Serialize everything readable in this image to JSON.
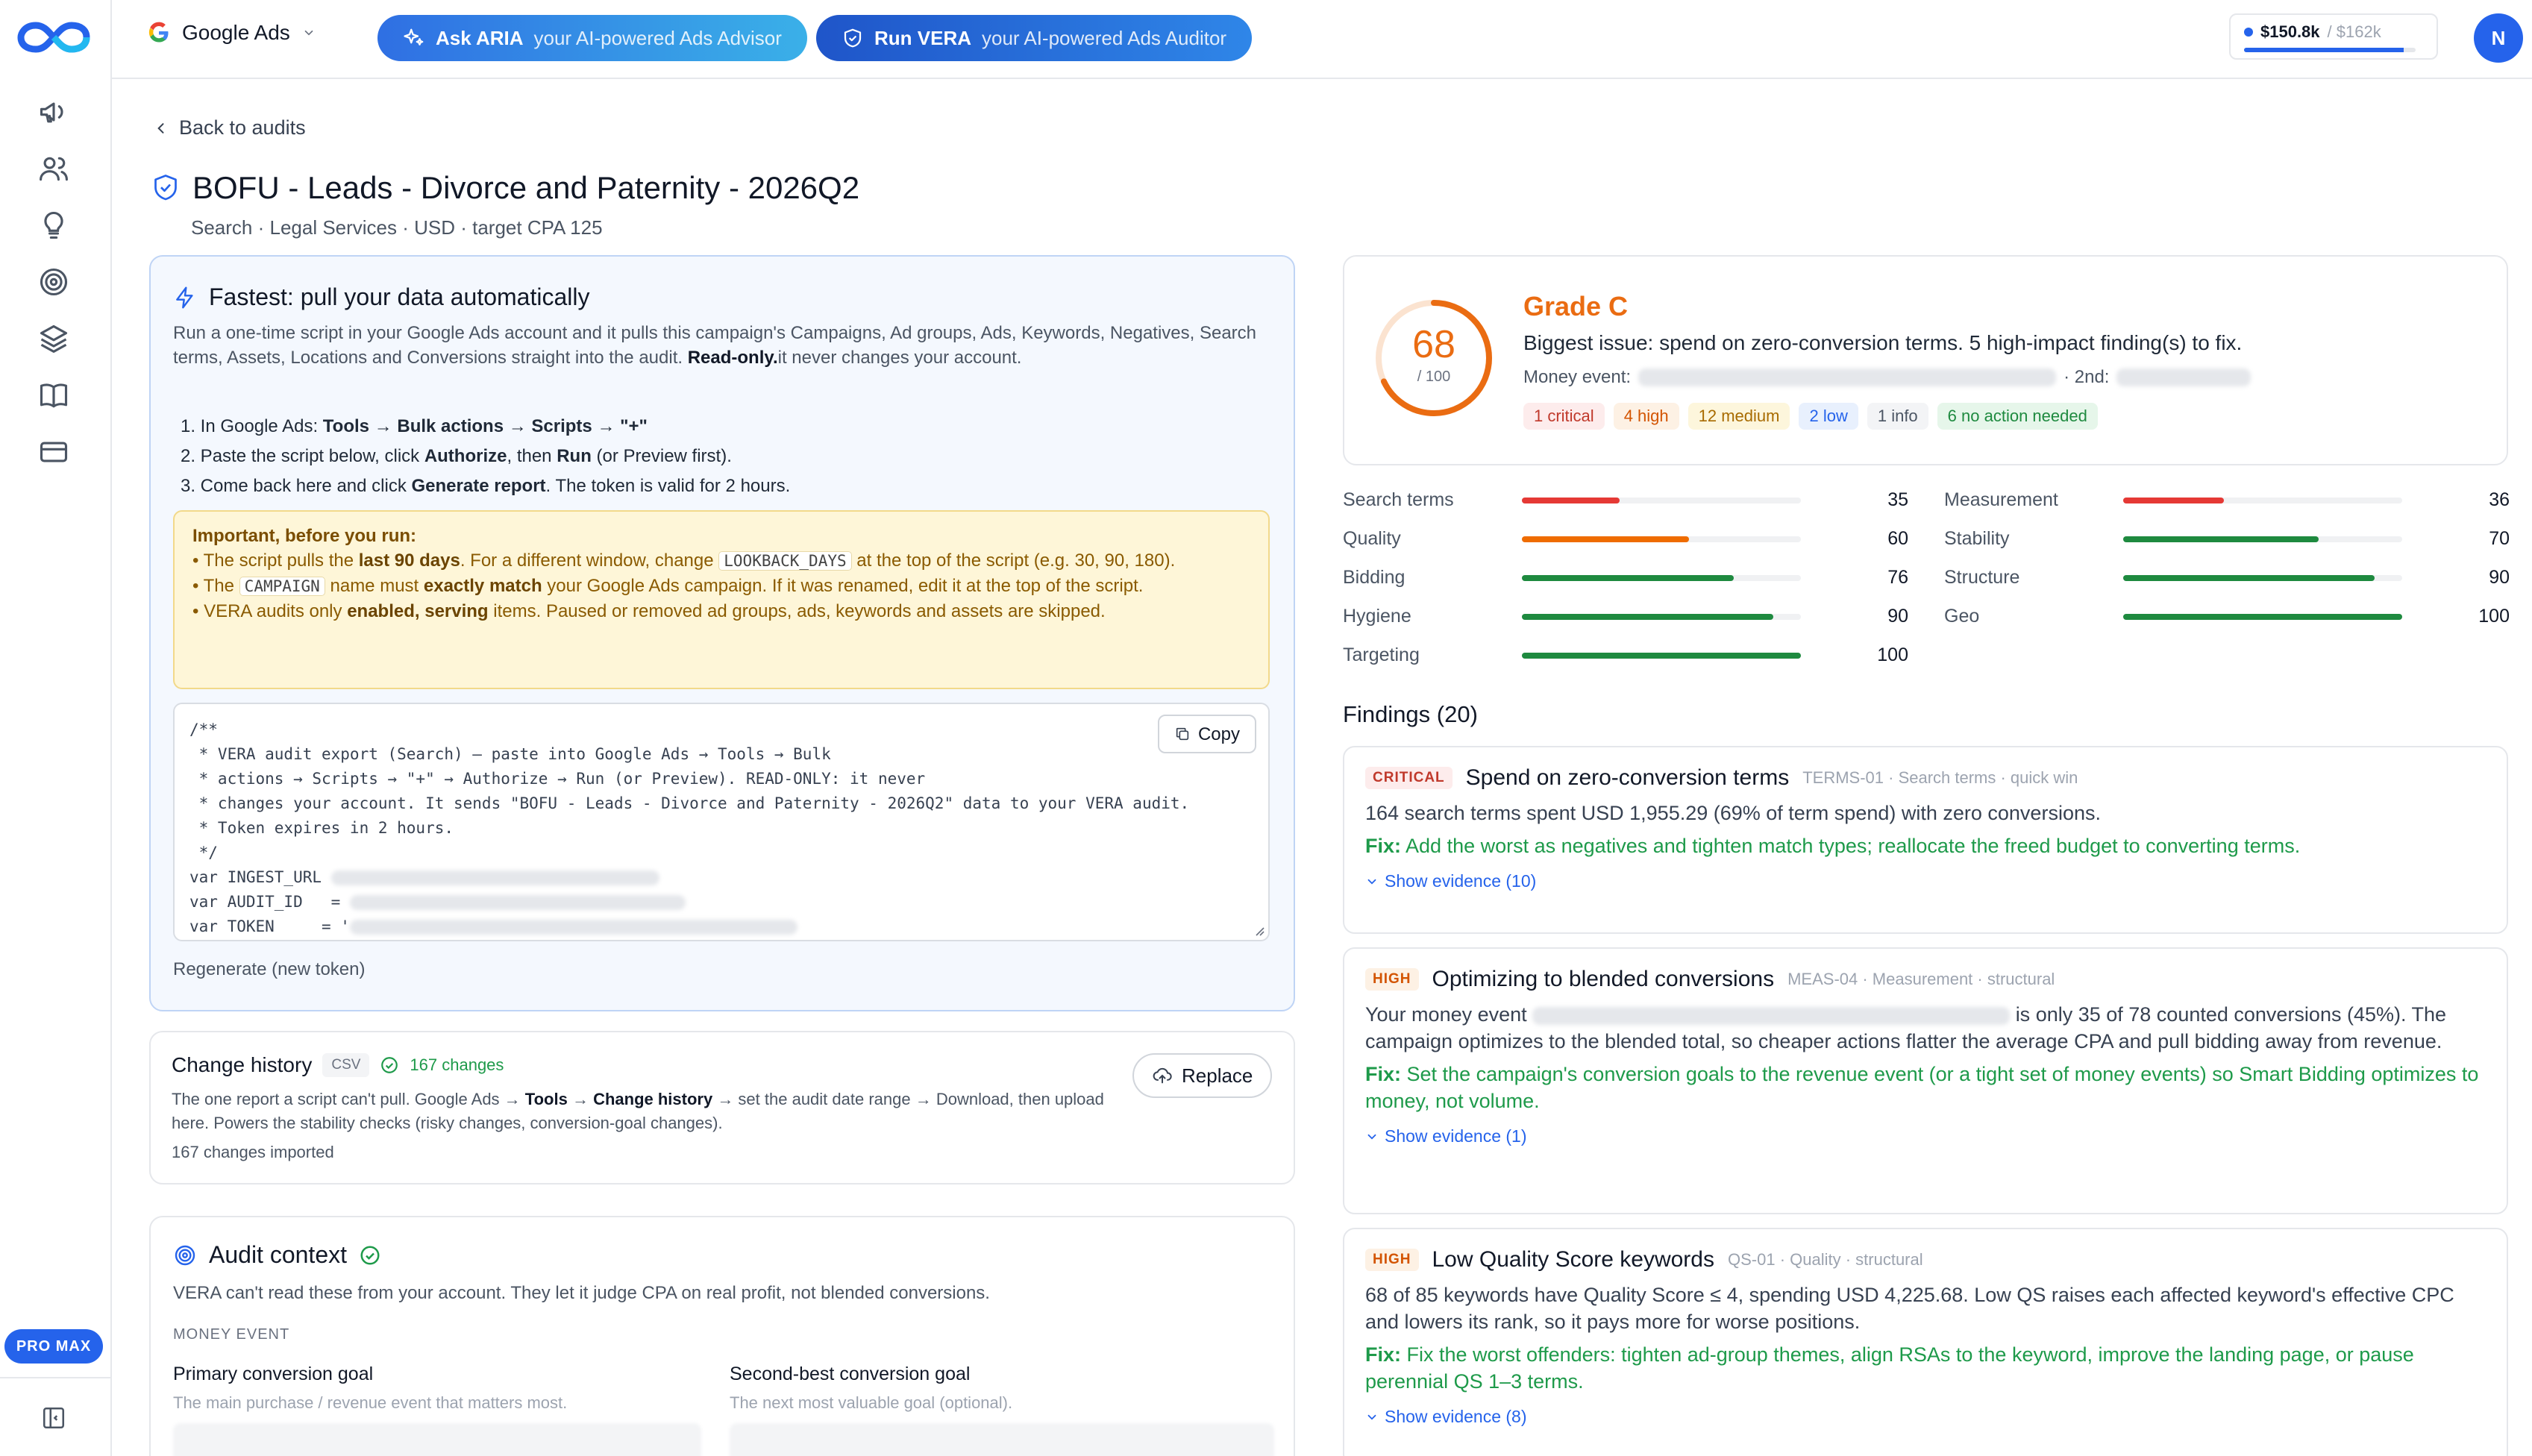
{
  "topbar": {
    "platform": "Google Ads",
    "aria_name": "Ask ARIA",
    "aria_sub": "your AI-powered Ads Advisor",
    "vera_name": "Run VERA",
    "vera_sub": "your AI-powered Ads Auditor",
    "budget_used": "$150.8k",
    "budget_sep": "/",
    "budget_limit": "$162k",
    "budget_fraction": 0.93,
    "avatar_initial": "N"
  },
  "sidebar": {
    "plan_badge": "PRO MAX",
    "icons": [
      "megaphone-icon",
      "users-icon",
      "lightbulb-icon",
      "target-icon",
      "layers-icon",
      "book-icon",
      "credit-card-icon"
    ]
  },
  "page": {
    "back_label": "Back to audits",
    "title": "BOFU - Leads - Divorce and Paternity - 2026Q2",
    "subtitle": "Search · Legal Services · USD · target CPA 125"
  },
  "auto_pull": {
    "title": "Fastest: pull your data automatically",
    "intro_a": "Run a one-time script in your Google Ads account and it pulls this campaign's Campaigns, Ad groups, Ads, Keywords, Negatives, Search terms, Assets, Locations and Conversions straight into the audit.",
    "intro_b": "Read-only.",
    "intro_c": "it never changes your account.",
    "step1_a": "1. In Google Ads: ",
    "step1_b": "Tools",
    "step1_c": " → ",
    "step1_d": "Bulk actions",
    "step1_e": " → ",
    "step1_f": "Scripts",
    "step1_g": " → ",
    "step1_h": "\"+\"",
    "step2_a": "2. Paste the script below, click ",
    "step2_b": "Authorize",
    "step2_c": ", then ",
    "step2_d": "Run",
    "step2_e": " (or Preview first).",
    "step3_a": "3. Come back here and click ",
    "step3_b": "Generate report",
    "step3_c": ". The token is valid for 2 hours.",
    "warn_title": "Important, before you run:",
    "warn1_a": "• The script pulls the ",
    "warn1_b": "last 90 days",
    "warn1_c": ". For a different window, change ",
    "warn1_code": "LOOKBACK_DAYS",
    "warn1_d": " at the top of the script (e.g. 30, 90, 180).",
    "warn2_a": "• The ",
    "warn2_code": "CAMPAIGN",
    "warn2_b": " name must ",
    "warn2_c": "exactly match",
    "warn2_d": " your Google Ads campaign. If it was renamed, edit it at the top of the script.",
    "warn3_a": "• VERA audits only ",
    "warn3_b": "enabled, serving",
    "warn3_c": " items. Paused or removed ad groups, ads, keywords and assets are skipped.",
    "code_lines": [
      "/**",
      " * VERA audit export (Search) — paste into Google Ads → Tools → Bulk",
      " * actions → Scripts → \"+\" → Authorize → Run (or Preview). READ-ONLY: it never",
      " * changes your account. It sends \"BOFU - Leads - Divorce and Paternity - 2026Q2\" data to your VERA audit.",
      " * Token expires in 2 hours.",
      " */",
      "var INGEST_URL",
      "var AUDIT_ID   =",
      "var TOKEN     = '"
    ],
    "copy_label": "Copy",
    "regen_label": "Regenerate (new token)"
  },
  "change_history": {
    "title": "Change history",
    "format": "CSV",
    "count_label": "167 changes",
    "desc_a": "The one report a script can't pull. Google Ads → ",
    "desc_b": "Tools",
    "desc_c": " → ",
    "desc_d": "Change history",
    "desc_e": " → set the audit date range → Download, then upload here. Powers the stability checks (risky changes, conversion-goal changes).",
    "imported": "167 changes imported",
    "replace_label": "Replace"
  },
  "audit_context": {
    "title": "Audit context",
    "desc": "VERA can't read these from your account. They let it judge CPA on real profit, not blended conversions.",
    "section": "MONEY EVENT",
    "primary_label": "Primary conversion goal",
    "primary_help": "The main purchase / revenue event that matters most.",
    "secondary_label": "Second-best conversion goal",
    "secondary_help": "The next most valuable goal (optional)."
  },
  "grade": {
    "score": "68",
    "score_max": "/ 100",
    "score_value": 68,
    "letter": "Grade C",
    "biggest_issue": "Biggest issue: spend on zero-conversion terms. 5 high-impact finding(s) to fix.",
    "money_label": "Money event:",
    "second_label": "· 2nd:",
    "chips": [
      {
        "label": "1 critical",
        "bg": "#fdecec",
        "fg": "#c0392b"
      },
      {
        "label": "4 high",
        "bg": "#fdf1e4",
        "fg": "#d35400"
      },
      {
        "label": "12 medium",
        "bg": "#fdf6dc",
        "fg": "#a86b00"
      },
      {
        "label": "2 low",
        "bg": "#e8f0fd",
        "fg": "#2563eb"
      },
      {
        "label": "1 info",
        "bg": "#f3f4f6",
        "fg": "#4b5563"
      },
      {
        "label": "6 no action needed",
        "bg": "#e6f6ea",
        "fg": "#1e8a3f"
      }
    ]
  },
  "scores_left": [
    {
      "label": "Search terms",
      "value": "35",
      "pct": 35,
      "color": "#e53935"
    },
    {
      "label": "Quality",
      "value": "60",
      "pct": 60,
      "color": "#ef6c00"
    },
    {
      "label": "Bidding",
      "value": "76",
      "pct": 76,
      "color": "#1e8a3f"
    },
    {
      "label": "Hygiene",
      "value": "90",
      "pct": 90,
      "color": "#1e8a3f"
    },
    {
      "label": "Targeting",
      "value": "100",
      "pct": 100,
      "color": "#1e8a3f"
    }
  ],
  "scores_right": [
    {
      "label": "Measurement",
      "value": "36",
      "pct": 36,
      "color": "#e53935"
    },
    {
      "label": "Stability",
      "value": "70",
      "pct": 70,
      "color": "#1e8a3f"
    },
    {
      "label": "Structure",
      "value": "90",
      "pct": 90,
      "color": "#1e8a3f"
    },
    {
      "label": "Geo",
      "value": "100",
      "pct": 100,
      "color": "#1e8a3f"
    }
  ],
  "findings_title": "Findings (20)",
  "findings": [
    {
      "sev": "CRITICAL",
      "title": "Spend on zero-conversion terms",
      "meta": "TERMS-01 · Search terms · quick win",
      "desc": "164 search terms spent USD 1,955.29 (69% of term spend) with zero conversions.",
      "fix_label": "Fix:",
      "fix": " Add the worst as negatives and tighten match types; reallocate the freed budget to converting terms.",
      "evidence": "Show evidence (10)"
    },
    {
      "sev": "HIGH",
      "title": "Optimizing to blended conversions",
      "meta": "MEAS-04 · Measurement · structural",
      "desc_a": "Your money event",
      "desc_b": "is only 35 of 78 counted conversions (45%).",
      "desc_c": "The campaign optimizes to the blended total, so cheaper actions flatter the average CPA and pull bidding away from revenue.",
      "fix_label": "Fix:",
      "fix": " Set the campaign's conversion goals to the revenue event (or a tight set of money events) so Smart Bidding optimizes to money, not volume.",
      "evidence": "Show evidence (1)"
    },
    {
      "sev": "HIGH",
      "title": "Low Quality Score keywords",
      "meta": "QS-01 · Quality · structural",
      "desc": "68 of 85 keywords have Quality Score ≤ 4, spending USD 4,225.68. Low QS raises each affected keyword's effective CPC and lowers its rank, so it pays more for worse positions.",
      "fix_label": "Fix:",
      "fix": " Fix the worst offenders: tighten ad-group themes, align RSAs to the keyword, improve the landing page, or pause perennial QS 1–3 terms.",
      "evidence": "Show evidence (8)"
    }
  ]
}
